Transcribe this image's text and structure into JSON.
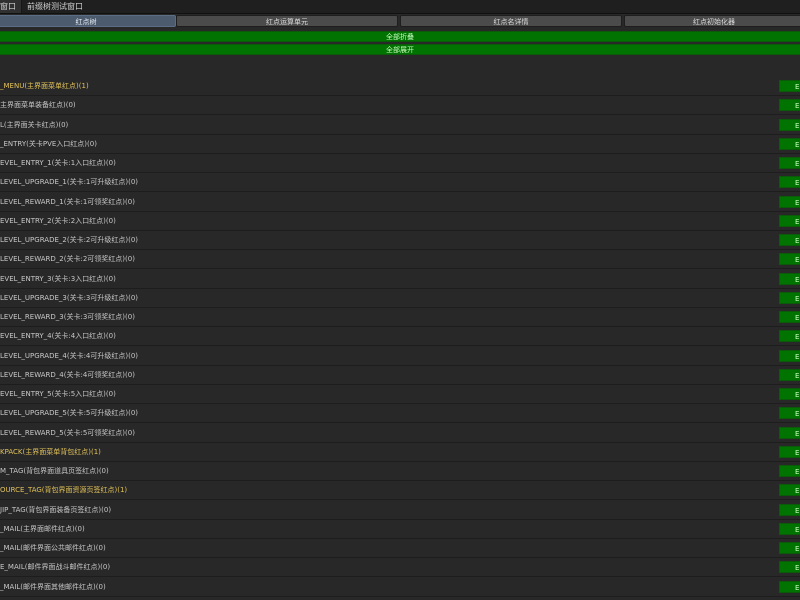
{
  "window_tabs": [
    "窗口",
    "前缀树测试窗口"
  ],
  "toolbar_tabs": [
    "红点树",
    "红点运算单元",
    "红点名详情",
    "红点初始化器"
  ],
  "collapse_all_label": "全部折叠",
  "expand_all_label": "全部展开",
  "row_button_label": "E",
  "tree_rows": [
    {
      "label": "_MENU(主界面菜单红点)(1)",
      "highlight": true
    },
    {
      "label": "主界面菜单装备红点)(0)",
      "highlight": false
    },
    {
      "label": "L(主界面关卡红点)(0)",
      "highlight": false
    },
    {
      "label": "_ENTRY(关卡PVE入口红点)(0)",
      "highlight": false
    },
    {
      "label": "EVEL_ENTRY_1(关卡:1入口红点)(0)",
      "highlight": false
    },
    {
      "label": "LEVEL_UPGRADE_1(关卡:1可升级红点)(0)",
      "highlight": false
    },
    {
      "label": "LEVEL_REWARD_1(关卡:1可领奖红点)(0)",
      "highlight": false
    },
    {
      "label": "EVEL_ENTRY_2(关卡:2入口红点)(0)",
      "highlight": false
    },
    {
      "label": "LEVEL_UPGRADE_2(关卡:2可升级红点)(0)",
      "highlight": false
    },
    {
      "label": "LEVEL_REWARD_2(关卡:2可领奖红点)(0)",
      "highlight": false
    },
    {
      "label": "EVEL_ENTRY_3(关卡:3入口红点)(0)",
      "highlight": false
    },
    {
      "label": "LEVEL_UPGRADE_3(关卡:3可升级红点)(0)",
      "highlight": false
    },
    {
      "label": "LEVEL_REWARD_3(关卡:3可领奖红点)(0)",
      "highlight": false
    },
    {
      "label": "EVEL_ENTRY_4(关卡:4入口红点)(0)",
      "highlight": false
    },
    {
      "label": "LEVEL_UPGRADE_4(关卡:4可升级红点)(0)",
      "highlight": false
    },
    {
      "label": "LEVEL_REWARD_4(关卡:4可领奖红点)(0)",
      "highlight": false
    },
    {
      "label": "EVEL_ENTRY_5(关卡:5入口红点)(0)",
      "highlight": false
    },
    {
      "label": "LEVEL_UPGRADE_5(关卡:5可升级红点)(0)",
      "highlight": false
    },
    {
      "label": "LEVEL_REWARD_5(关卡:5可领奖红点)(0)",
      "highlight": false
    },
    {
      "label": "KPACK(主界面菜单背包红点)(1)",
      "highlight": true
    },
    {
      "label": "M_TAG(背包界面道具页签红点)(0)",
      "highlight": false
    },
    {
      "label": "OURCE_TAG(背包界面资源页签红点)(1)",
      "highlight": true
    },
    {
      "label": "JIP_TAG(背包界面装备页签红点)(0)",
      "highlight": false
    },
    {
      "label": "_MAIL(主界面邮件红点)(0)",
      "highlight": false
    },
    {
      "label": "_MAIL(邮件界面公共邮件红点)(0)",
      "highlight": false
    },
    {
      "label": "E_MAIL(邮件界面战斗邮件红点)(0)",
      "highlight": false
    },
    {
      "label": "_MAIL(邮件界面其他邮件红点)(0)",
      "highlight": false
    }
  ]
}
